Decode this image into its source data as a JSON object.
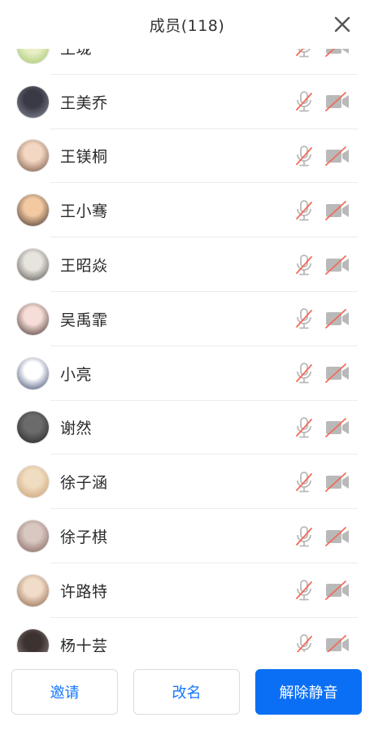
{
  "header": {
    "title": "成员(118)"
  },
  "members": [
    {
      "name": "王珑",
      "colors": [
        "#e8efc4",
        "#9fc36b"
      ]
    },
    {
      "name": "王美乔",
      "colors": [
        "#3a3a46",
        "#8b8f9c"
      ]
    },
    {
      "name": "王镁桐",
      "colors": [
        "#f3d7c2",
        "#6e4a3a"
      ]
    },
    {
      "name": "王小骞",
      "colors": [
        "#f2c9a1",
        "#3a2a25"
      ]
    },
    {
      "name": "王昭焱",
      "colors": [
        "#e7e3dd",
        "#4d4a47"
      ]
    },
    {
      "name": "吴禹霏",
      "colors": [
        "#f7ddd7",
        "#3d2a25"
      ]
    },
    {
      "name": "小亮",
      "colors": [
        "#ffffff",
        "#2e3b66"
      ]
    },
    {
      "name": "谢然",
      "colors": [
        "#6b6b6b",
        "#1f1f1f"
      ]
    },
    {
      "name": "徐子涵",
      "colors": [
        "#f0dcc0",
        "#c69a6c"
      ]
    },
    {
      "name": "徐子棋",
      "colors": [
        "#d9c7c2",
        "#7c5a52"
      ]
    },
    {
      "name": "许路特",
      "colors": [
        "#f1dcc9",
        "#8a5c40"
      ]
    },
    {
      "name": "杨十芸",
      "colors": [
        "#3c3230",
        "#9b8a84"
      ]
    }
  ],
  "footer": {
    "invite_label": "邀请",
    "rename_label": "改名",
    "unmute_label": "解除静音"
  },
  "colors": {
    "accent": "#0b6ff5",
    "muted_icon": "#b9b9b9",
    "slash": "#f26b5b"
  }
}
